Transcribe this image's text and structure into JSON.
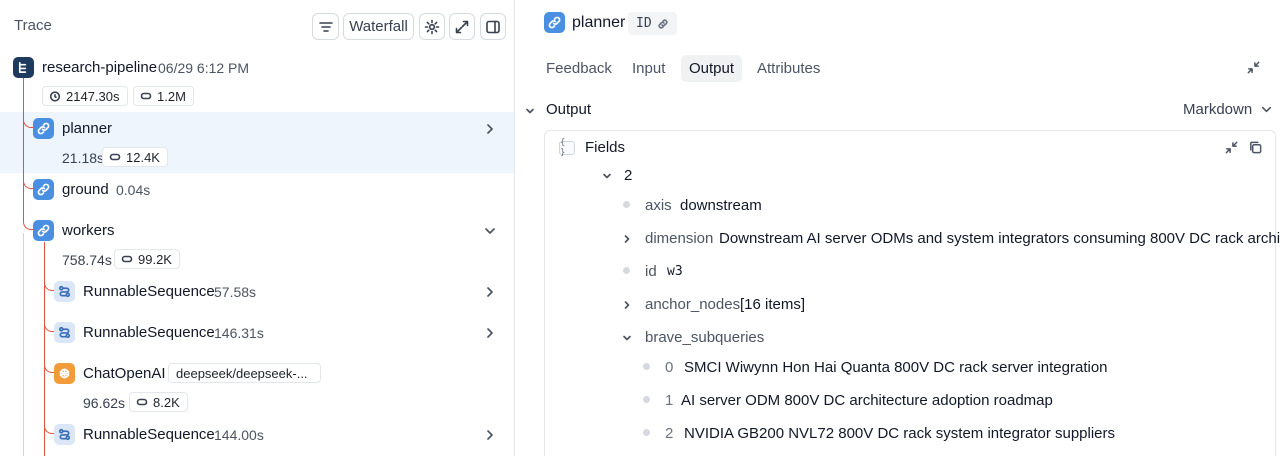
{
  "left": {
    "title": "Trace",
    "toolbar": {
      "view_label": "Waterfall"
    },
    "root": {
      "name": "research-pipeline",
      "date": "06/29 6:12 PM",
      "duration": "2147.30s",
      "tokens": "1.2M"
    },
    "nodes": [
      {
        "name": "planner",
        "duration": "21.18s",
        "tokens": "12.4K"
      },
      {
        "name": "ground",
        "duration": "0.04s"
      },
      {
        "name": "workers",
        "duration": "758.74s",
        "tokens": "99.2K"
      },
      {
        "name": "RunnableSequence",
        "duration": "57.58s"
      },
      {
        "name": "RunnableSequence",
        "duration": "146.31s"
      },
      {
        "name": "ChatOpenAI",
        "model": "deepseek/deepseek-...",
        "duration": "96.62s",
        "tokens": "8.2K"
      },
      {
        "name": "RunnableSequence",
        "duration": "144.00s"
      }
    ]
  },
  "right": {
    "title": "planner",
    "id_label": "ID",
    "tabs": [
      "Feedback",
      "Input",
      "Output",
      "Attributes"
    ],
    "active_tab": "Output",
    "section": "Output",
    "format": "Markdown",
    "fields_title": "Fields",
    "tree": {
      "index": "2",
      "axis_key": "axis",
      "axis_val": "downstream",
      "dimension_key": "dimension",
      "dimension_val": "Downstream AI server ODMs and system integrators consuming 800V DC rack architect...",
      "id_key": "id",
      "id_val": "w3",
      "anchor_key": "anchor_nodes",
      "anchor_val": "[16 items]",
      "brave_key": "brave_subqueries",
      "brave": [
        {
          "i": "0",
          "text": "SMCI Wiwynn Hon Hai Quanta 800V DC rack server integration"
        },
        {
          "i": "1",
          "text": "AI server ODM 800V DC architecture adoption roadmap"
        },
        {
          "i": "2",
          "text": "NVIDIA GB200 NVL72 800V DC rack system integrator suppliers"
        }
      ]
    }
  },
  "colors": {
    "accent": "#4a90e2",
    "trace_line": "#e2533f",
    "highlight": "#eef5fd",
    "root_icon": "#1e3a5f",
    "ai_icon": "#f29b3b"
  }
}
